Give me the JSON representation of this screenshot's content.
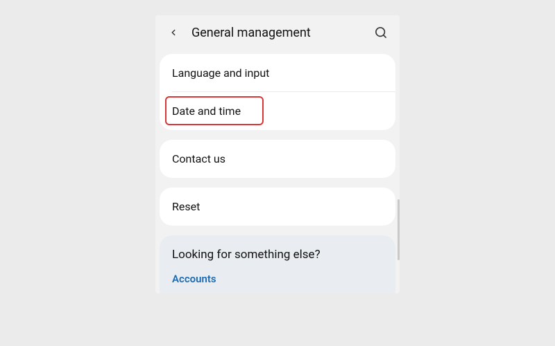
{
  "header": {
    "title": "General management"
  },
  "sections": {
    "language_input": "Language and input",
    "date_time": "Date and time",
    "contact_us": "Contact us",
    "reset": "Reset"
  },
  "suggestion": {
    "title": "Looking for something else?",
    "link": "Accounts"
  }
}
